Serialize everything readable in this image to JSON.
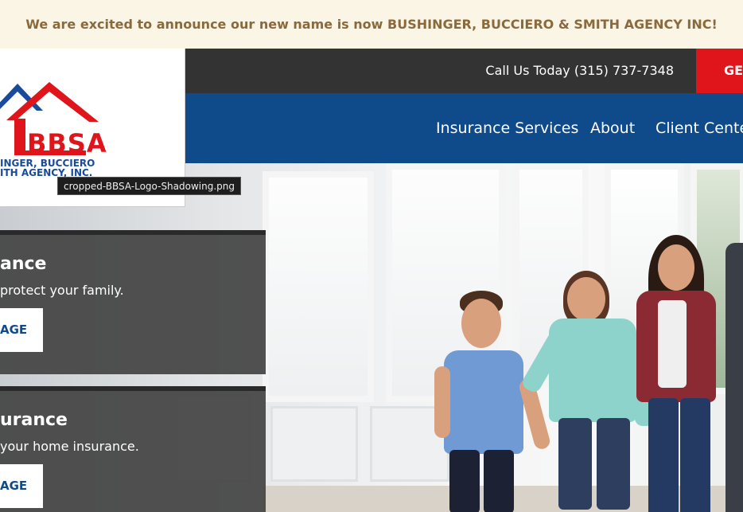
{
  "announcement": "We are excited to announce our new name is now BUSHINGER, BUCCIERO & SMITH AGENCY INC!",
  "topbar": {
    "phone": "Call Us Today (315) 737-7348",
    "cta_label": "GET"
  },
  "nav": {
    "items": [
      {
        "label": "Insurance Services"
      },
      {
        "label": "About"
      },
      {
        "label": "Client Center"
      }
    ]
  },
  "logo": {
    "initials": "BBSA",
    "line1": "INGER, BUCCIERO",
    "line2": "ITH AGENCY, INC.",
    "colors": {
      "red": "#e0141b",
      "blue": "#1a4a9a"
    }
  },
  "tooltip": "cropped-BBSA-Logo-Shadowing.png",
  "panels": [
    {
      "title": "ance",
      "subtitle": "protect your family.",
      "button": "AGE"
    },
    {
      "title": "urance",
      "subtitle": "your home insurance.",
      "button": "AGE"
    }
  ],
  "colors": {
    "announce_bg": "#fbf5e6",
    "announce_text": "#8a6a3c",
    "topbar": "#333333",
    "cta": "#e0141b",
    "nav": "#0f4a8a"
  }
}
